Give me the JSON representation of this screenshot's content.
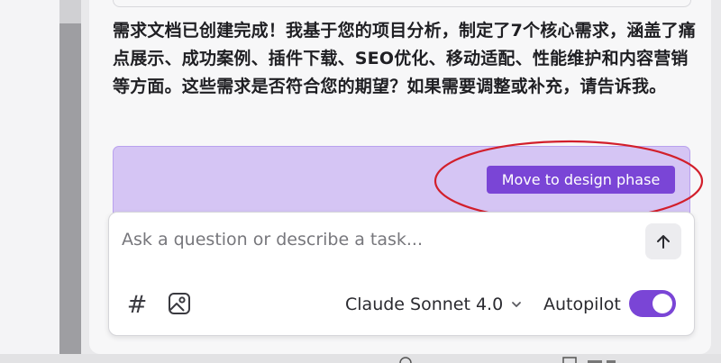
{
  "chat": {
    "message": "需求文档已创建完成！我基于您的项目分析，制定了7个核心需求，涵盖了痛点展示、成功案例、插件下载、SEO优化、移动适配、性能维护和内容营销等方面。这些需求是否符合您的期望？如果需要调整或补充，请告诉我。"
  },
  "action": {
    "design_button_label": "Move to design phase"
  },
  "composer": {
    "placeholder": "Ask a question or describe a task...",
    "hash_symbol": "#",
    "model_label": "Claude Sonnet 4.0",
    "autopilot_label": "Autopilot",
    "autopilot_on": true
  },
  "icons": {
    "send": "arrow-up-icon",
    "hash": "hash-icon",
    "image": "image-icon",
    "chevron": "chevron-down-icon"
  },
  "colors": {
    "accent": "#7a45d6",
    "purple_area": "#d5c5f4",
    "annotation_ring": "#d21f2b"
  }
}
